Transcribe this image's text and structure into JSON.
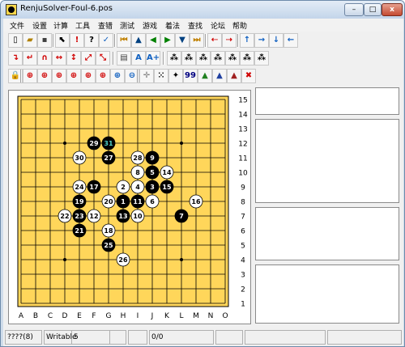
{
  "window": {
    "title": "RenjuSolver-Foul-6.pos",
    "min_label": "–",
    "max_label": "□",
    "close_label": "x"
  },
  "menu": [
    "文件",
    "设置",
    "计算",
    "工具",
    "查错",
    "测试",
    "游戏",
    "着法",
    "查找",
    "论坛",
    "帮助"
  ],
  "toolbar1": [
    {
      "name": "new-file-icon",
      "glyph": "▯",
      "color": "#000000"
    },
    {
      "name": "open-folder-icon",
      "glyph": "▰",
      "color": "#b08000"
    },
    {
      "name": "save-disk-icon",
      "glyph": "▪",
      "color": "#404040"
    },
    {
      "name": "pointer-icon",
      "glyph": "⬉",
      "color": "#000000"
    },
    {
      "name": "exclamation-icon",
      "glyph": "!",
      "color": "#d00000"
    },
    {
      "name": "question-icon",
      "glyph": "?",
      "color": "#000000"
    },
    {
      "name": "checkmark-icon",
      "glyph": "✓",
      "color": "#1060c0"
    },
    {
      "name": "first-move-icon",
      "glyph": "⏮",
      "color": "#c08000"
    },
    {
      "name": "up-triangle-icon",
      "glyph": "▲",
      "color": "#004080"
    },
    {
      "name": "back-triangle-icon",
      "glyph": "◀",
      "color": "#008000"
    },
    {
      "name": "forward-triangle-icon",
      "glyph": "▶",
      "color": "#008000"
    },
    {
      "name": "down-triangle-icon",
      "glyph": "▼",
      "color": "#004080"
    },
    {
      "name": "last-move-icon",
      "glyph": "⏭",
      "color": "#c08000"
    },
    {
      "name": "merge-left-icon",
      "glyph": "⇠",
      "color": "#d00000"
    },
    {
      "name": "merge-right-icon",
      "glyph": "⇢",
      "color": "#d00000"
    },
    {
      "name": "arrow-up-icon",
      "glyph": "↑",
      "color": "#1060c0"
    },
    {
      "name": "arrow-right-icon",
      "glyph": "→",
      "color": "#1060c0"
    },
    {
      "name": "arrow-down-icon",
      "glyph": "↓",
      "color": "#1060c0"
    },
    {
      "name": "arrow-left-icon",
      "glyph": "←",
      "color": "#1060c0"
    }
  ],
  "toolbar2": [
    {
      "name": "rotate-right-icon",
      "glyph": "↴",
      "color": "#d00000"
    },
    {
      "name": "rotate-left-icon",
      "glyph": "↵",
      "color": "#d00000"
    },
    {
      "name": "flip-icon",
      "glyph": "∩",
      "color": "#d00000"
    },
    {
      "name": "flip-horizontal-icon",
      "glyph": "↔",
      "color": "#d00000"
    },
    {
      "name": "flip-vertical-icon",
      "glyph": "↕",
      "color": "#d00000"
    },
    {
      "name": "diagonal-up-icon",
      "glyph": "⤢",
      "color": "#d00000"
    },
    {
      "name": "diagonal-down-icon",
      "glyph": "⤡",
      "color": "#d00000"
    },
    {
      "name": "board-view-icon",
      "glyph": "▤",
      "color": "#404040"
    },
    {
      "name": "font-a-icon",
      "glyph": "A",
      "color": "#1060c0"
    },
    {
      "name": "font-a-plus-icon",
      "glyph": "A+",
      "color": "#1060c0"
    },
    {
      "name": "stones-1-icon",
      "glyph": "⁂",
      "color": "#000000"
    },
    {
      "name": "stones-2-icon",
      "glyph": "⁂",
      "color": "#000000"
    },
    {
      "name": "stones-3-icon",
      "glyph": "⁂",
      "color": "#000000"
    },
    {
      "name": "stones-4-icon",
      "glyph": "⁂",
      "color": "#000000"
    },
    {
      "name": "stones-5-icon",
      "glyph": "⁂",
      "color": "#000000"
    },
    {
      "name": "stones-6-icon",
      "glyph": "⁂",
      "color": "#000000"
    },
    {
      "name": "stones-7-icon",
      "glyph": "⁂",
      "color": "#000000"
    }
  ],
  "toolbar3": [
    {
      "name": "lock-icon",
      "glyph": "🔒",
      "color": "#806000"
    },
    {
      "name": "zoom-1-icon",
      "glyph": "⊕",
      "color": "#d00000"
    },
    {
      "name": "zoom-2-icon",
      "glyph": "⊕",
      "color": "#d00000"
    },
    {
      "name": "zoom-3-icon",
      "glyph": "⊕",
      "color": "#d00000"
    },
    {
      "name": "zoom-4-icon",
      "glyph": "⊕",
      "color": "#d00000"
    },
    {
      "name": "zoom-5-icon",
      "glyph": "⊕",
      "color": "#d00000"
    },
    {
      "name": "zoom-6-icon",
      "glyph": "⊕",
      "color": "#d00000"
    },
    {
      "name": "zoom-in-icon",
      "glyph": "⊕",
      "color": "#1060c0"
    },
    {
      "name": "zoom-out-icon",
      "glyph": "⊖",
      "color": "#1060c0"
    },
    {
      "name": "crosshair-icon",
      "glyph": "✛",
      "color": "#808080"
    },
    {
      "name": "dotted-icon",
      "glyph": "⁙",
      "color": "#000000"
    },
    {
      "name": "black-stone-icon",
      "glyph": "✦",
      "color": "#000000"
    },
    {
      "name": "number-99-icon",
      "glyph": "99",
      "color": "#000080"
    },
    {
      "name": "triangle-green-icon",
      "glyph": "▲",
      "color": "#208020"
    },
    {
      "name": "triangle-blue-icon",
      "glyph": "▲",
      "color": "#2040a0"
    },
    {
      "name": "triangle-red-icon",
      "glyph": "▲",
      "color": "#a02020"
    },
    {
      "name": "close-x-icon",
      "glyph": "✖",
      "color": "#d00000"
    }
  ],
  "board": {
    "size": 15,
    "columns": [
      "A",
      "B",
      "C",
      "D",
      "E",
      "F",
      "G",
      "H",
      "I",
      "J",
      "K",
      "L",
      "M",
      "N",
      "O"
    ],
    "rows": [
      "15",
      "14",
      "13",
      "12",
      "11",
      "10",
      "9",
      "8",
      "7",
      "6",
      "5",
      "4",
      "3",
      "2",
      "1"
    ],
    "board_color": "#ffd65a",
    "star_points": [
      "D12",
      "L12",
      "H8",
      "D4",
      "L4"
    ],
    "stones": [
      {
        "n": 1,
        "c": "black",
        "pos": "H8"
      },
      {
        "n": 2,
        "c": "white",
        "pos": "H9"
      },
      {
        "n": 3,
        "c": "black",
        "pos": "J9"
      },
      {
        "n": 4,
        "c": "white",
        "pos": "I9"
      },
      {
        "n": 5,
        "c": "black",
        "pos": "J10"
      },
      {
        "n": 6,
        "c": "white",
        "pos": "J8"
      },
      {
        "n": 7,
        "c": "black",
        "pos": "L7"
      },
      {
        "n": 8,
        "c": "white",
        "pos": "I10"
      },
      {
        "n": 9,
        "c": "black",
        "pos": "J11"
      },
      {
        "n": 10,
        "c": "white",
        "pos": "I7"
      },
      {
        "n": 11,
        "c": "black",
        "pos": "I8"
      },
      {
        "n": 12,
        "c": "white",
        "pos": "F7"
      },
      {
        "n": 13,
        "c": "black",
        "pos": "H7"
      },
      {
        "n": 14,
        "c": "white",
        "pos": "K10"
      },
      {
        "n": 15,
        "c": "black",
        "pos": "K9"
      },
      {
        "n": 16,
        "c": "white",
        "pos": "M8"
      },
      {
        "n": 17,
        "c": "black",
        "pos": "F9"
      },
      {
        "n": 18,
        "c": "white",
        "pos": "G6"
      },
      {
        "n": 19,
        "c": "black",
        "pos": "E8"
      },
      {
        "n": 20,
        "c": "white",
        "pos": "G8"
      },
      {
        "n": 21,
        "c": "black",
        "pos": "E6"
      },
      {
        "n": 22,
        "c": "white",
        "pos": "D7"
      },
      {
        "n": 23,
        "c": "black",
        "pos": "E7"
      },
      {
        "n": 24,
        "c": "white",
        "pos": "E9"
      },
      {
        "n": 25,
        "c": "black",
        "pos": "G5"
      },
      {
        "n": 26,
        "c": "white",
        "pos": "H4"
      },
      {
        "n": 27,
        "c": "black",
        "pos": "G11"
      },
      {
        "n": 28,
        "c": "white",
        "pos": "I11"
      },
      {
        "n": 29,
        "c": "black",
        "pos": "F12"
      },
      {
        "n": 30,
        "c": "white",
        "pos": "E11"
      },
      {
        "n": 31,
        "c": "black",
        "pos": "G12",
        "last": true
      }
    ]
  },
  "status": [
    "????(8)",
    "Writable",
    "5",
    "",
    "0/0",
    "",
    "",
    ""
  ]
}
